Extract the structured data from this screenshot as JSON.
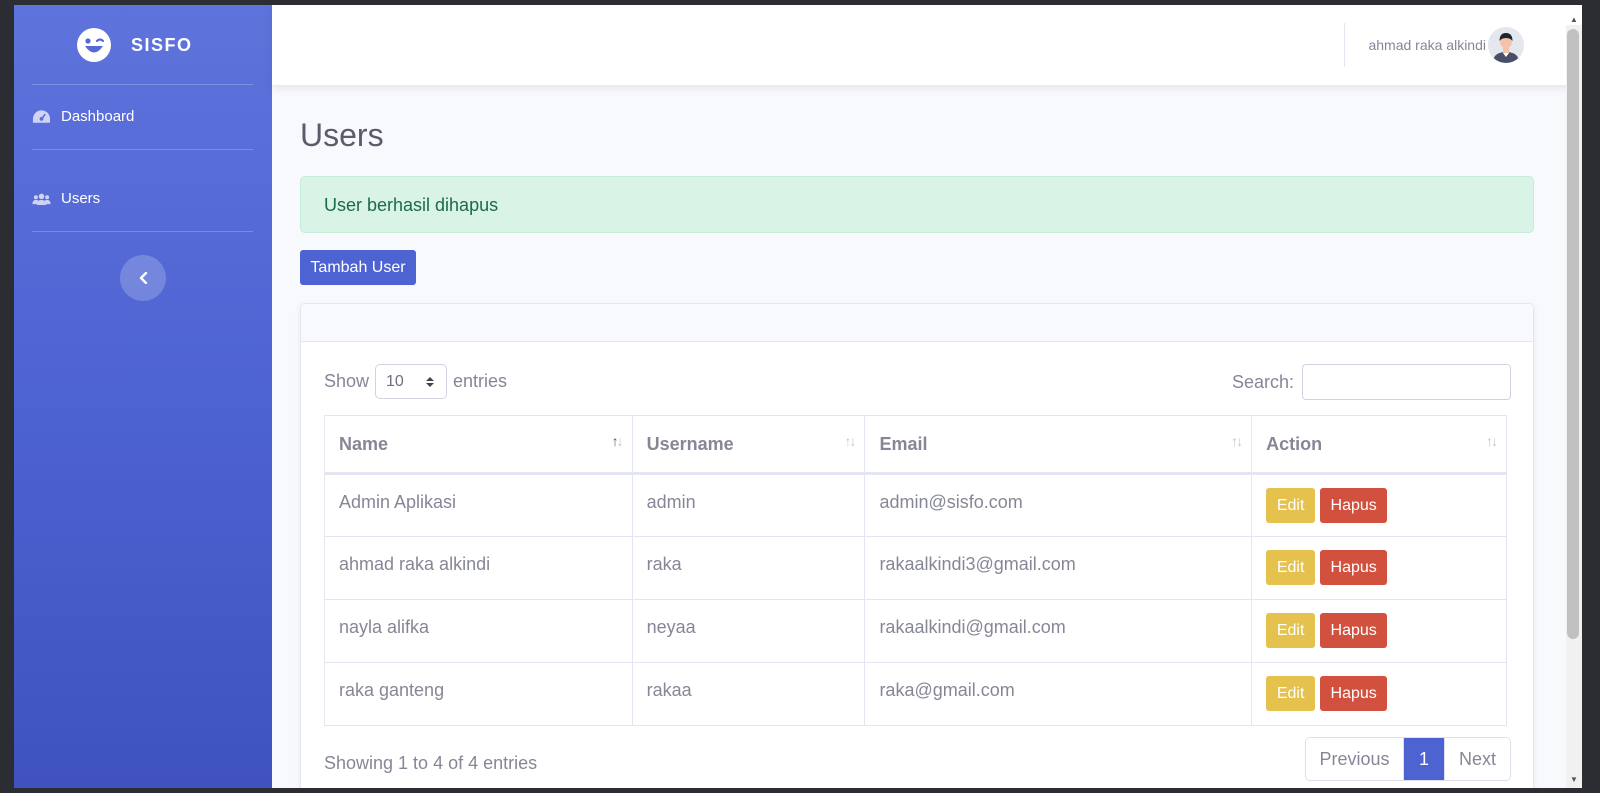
{
  "app": {
    "brand": "SISFO",
    "colors": {
      "primary": "#4e63d2",
      "success_bg": "#d9f3e6",
      "warning": "#e5c14e",
      "danger": "#d1513e"
    }
  },
  "sidebar": {
    "items": [
      {
        "label": "Dashboard",
        "icon": "tachometer-icon"
      },
      {
        "label": "Users",
        "icon": "users-icon"
      }
    ],
    "toggle_icon": "chevron-left-icon"
  },
  "topbar": {
    "user_name": "ahmad raka alkindi",
    "avatar_icon": "user-avatar"
  },
  "page": {
    "title": "Users",
    "alert": "User berhasil dihapus",
    "add_button": "Tambah User"
  },
  "table": {
    "show_label": "Show",
    "entries_value": "10",
    "entries_label": "entries",
    "search_label": "Search:",
    "search_value": "",
    "columns": [
      "Name",
      "Username",
      "Email",
      "Action"
    ],
    "rows": [
      {
        "name": "Admin Aplikasi",
        "username": "admin",
        "email": "admin@sisfo.com"
      },
      {
        "name": "ahmad raka alkindi",
        "username": "raka",
        "email": "rakaalkindi3@gmail.com"
      },
      {
        "name": "nayla alifka",
        "username": "neyaa",
        "email": "rakaalkindi@gmail.com"
      },
      {
        "name": "raka ganteng",
        "username": "rakaa",
        "email": "raka@gmail.com"
      }
    ],
    "edit_label": "Edit",
    "delete_label": "Hapus",
    "info": "Showing 1 to 4 of 4 entries",
    "pagination": {
      "previous": "Previous",
      "current": "1",
      "next": "Next"
    }
  }
}
